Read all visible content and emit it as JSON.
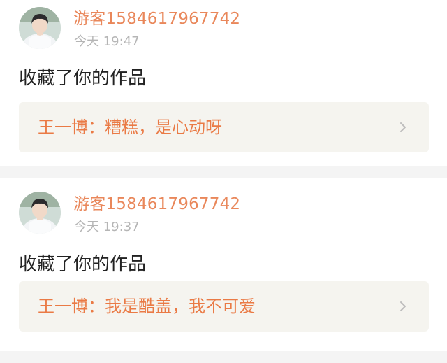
{
  "feed": {
    "items": [
      {
        "username": "游客1584617967742",
        "timestamp": "今天 19:47",
        "action": "收藏了你的作品",
        "quote": "王一博：糟糕，是心动呀",
        "avatar_icon": "user-avatar-photo",
        "chevron_icon": "chevron-right-icon"
      },
      {
        "username": "游客1584617967742",
        "timestamp": "今天 19:37",
        "action": "收藏了你的作品",
        "quote": "王一博：我是酷盖，我不可爱",
        "avatar_icon": "user-avatar-photo",
        "chevron_icon": "chevron-right-icon"
      }
    ]
  },
  "colors": {
    "username": "#e9875a",
    "quote_text": "#ea7a45",
    "timestamp": "#b5b5b5",
    "quote_background": "#f5f4ef",
    "separator": "#f4f4f4"
  }
}
